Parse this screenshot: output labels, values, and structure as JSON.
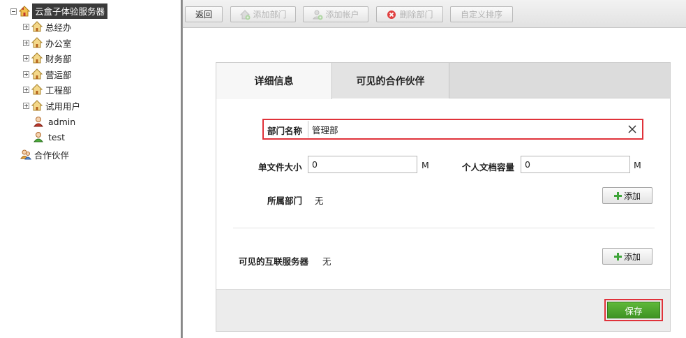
{
  "tree": {
    "root": {
      "label": "云盒子体验服务器"
    },
    "departments": [
      {
        "label": "总经办"
      },
      {
        "label": "办公室"
      },
      {
        "label": "财务部"
      },
      {
        "label": "营运部"
      },
      {
        "label": "工程部"
      },
      {
        "label": "试用用户"
      }
    ],
    "users": [
      {
        "label": "admin"
      },
      {
        "label": "test"
      }
    ],
    "partners": {
      "label": "合作伙伴"
    }
  },
  "toolbar": {
    "back": "返回",
    "add_department": "添加部门",
    "add_account": "添加帐户",
    "delete_department": "删除部门",
    "custom_sort": "自定义排序"
  },
  "tabs": {
    "details": "详细信息",
    "visible_partners": "可见的合作伙伴"
  },
  "form": {
    "dept_name_label": "部门名称",
    "dept_name_value": "管理部",
    "single_file_label": "单文件大小",
    "single_file_value": "0",
    "single_file_unit": "M",
    "personal_quota_label": "个人文档容量",
    "personal_quota_value": "0",
    "personal_quota_unit": "M",
    "parent_dept_label": "所属部门",
    "parent_dept_value": "无",
    "add_label": "添加",
    "servers_label": "可见的互联服务器",
    "servers_value": "无",
    "save": "保存"
  },
  "colors": {
    "highlight": "#e0323a",
    "save_green": "#4ea52e",
    "root_label_bg": "#3a3a3a"
  }
}
